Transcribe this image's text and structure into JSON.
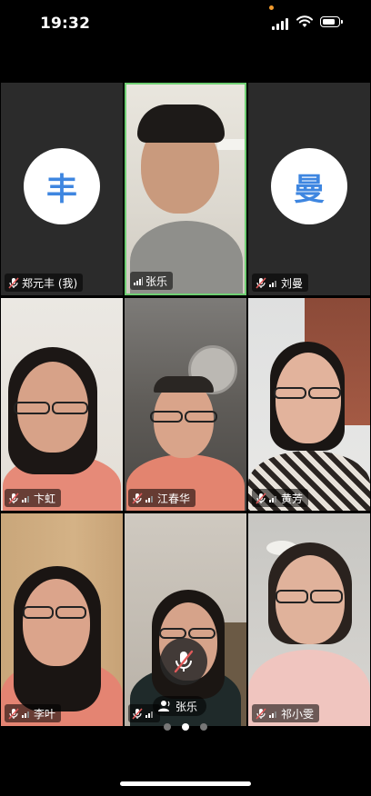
{
  "status_bar": {
    "time": "19:32"
  },
  "participants": [
    {
      "name": "郑元丰 (我)",
      "type": "avatar",
      "avatar_char": "丰",
      "mic": "muted"
    },
    {
      "name": "张乐",
      "type": "video",
      "mic": "active",
      "active_speaker": true
    },
    {
      "name": "刘曼",
      "type": "avatar",
      "avatar_char": "曼",
      "mic": "muted"
    },
    {
      "name": "卞虹",
      "type": "video",
      "mic": "muted"
    },
    {
      "name": "江春华",
      "type": "video",
      "mic": "muted"
    },
    {
      "name": "黄芳",
      "type": "video",
      "mic": "muted"
    },
    {
      "name": "李叶",
      "type": "video",
      "mic": "muted"
    },
    {
      "name": "张乐",
      "type": "video",
      "mic": "muted"
    },
    {
      "name": "祁小雯",
      "type": "video",
      "mic": "muted"
    }
  ],
  "speaking_indicator": {
    "name": "张乐"
  },
  "pagination": {
    "pages": 3,
    "current": 2
  },
  "colors": {
    "avatar_text": "#3e86e0",
    "active_border": "#6fcf73",
    "muted_mic": "#e05a5a"
  }
}
